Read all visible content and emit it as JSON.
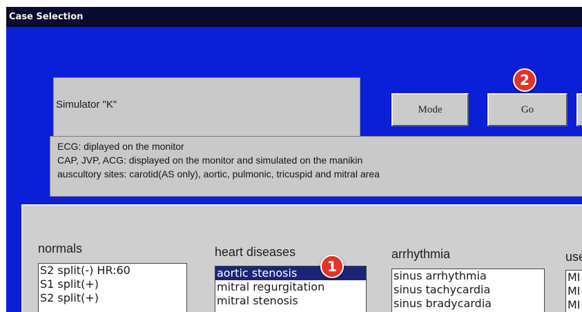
{
  "window": {
    "title": "Case Selection"
  },
  "simulator": {
    "label": "Simulator \"K\""
  },
  "buttons": {
    "mode": "Mode",
    "go": "Go"
  },
  "info": {
    "lines": [
      "ECG: diplayed on the monitor",
      "CAP, JVP, ACG: displayed on the monitor and simulated on the manikin",
      "auscultory sites: carotid(AS only), aortic, pulmonic, tricuspid and mitral area"
    ]
  },
  "groups": {
    "normals": {
      "label": "normals",
      "items": [
        "S2 split(-) HR:60",
        "S1 split(+)",
        "S2 split(+)"
      ]
    },
    "heart_diseases": {
      "label": "heart diseases",
      "items": [
        "aortic stenosis",
        "mitral regurgitation",
        "mitral stenosis"
      ],
      "selected": "aortic stenosis"
    },
    "arrhythmia": {
      "label": "arrhythmia",
      "items": [
        "sinus arrhythmia",
        "sinus tachycardia",
        "sinus bradycardia"
      ]
    },
    "partial": {
      "label": "use",
      "items": [
        "MI",
        "MI",
        "MI"
      ]
    }
  },
  "annotations": {
    "badge1": "1",
    "badge2": "2"
  },
  "colors": {
    "background": "#0b1fd8",
    "titlebar": "#0a0a2e",
    "panel": "#cfcfcf",
    "selection": "#1c2478",
    "badge": "#e5332a"
  }
}
